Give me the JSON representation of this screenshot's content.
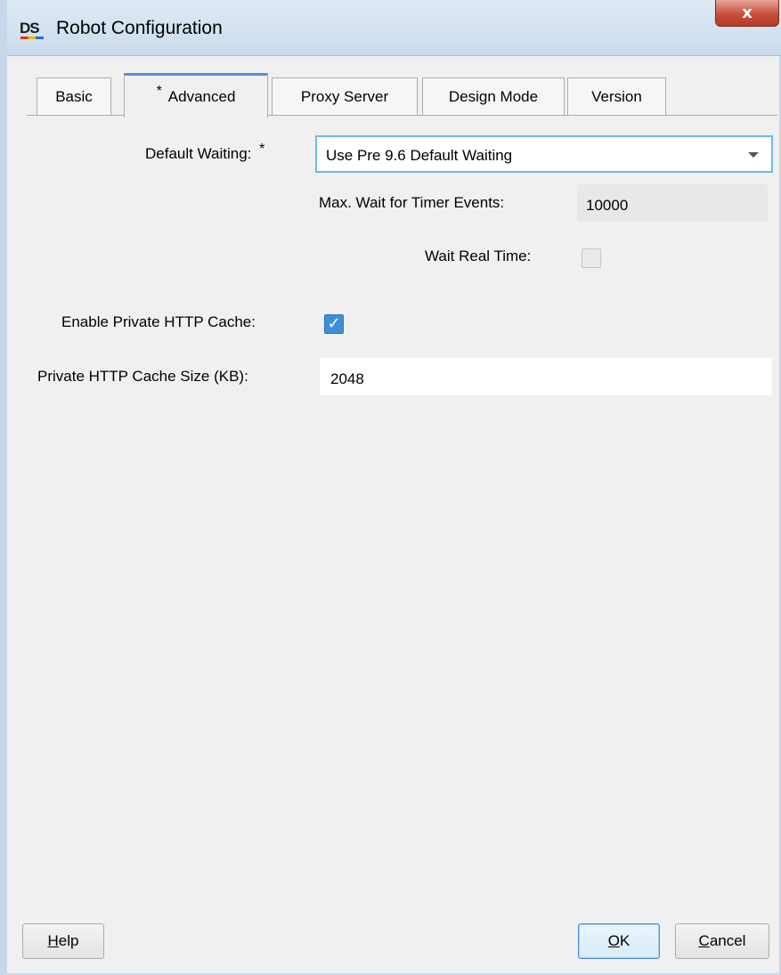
{
  "window": {
    "logo": "DS",
    "title": "Robot Configuration",
    "close_glyph": "x"
  },
  "tabs": [
    {
      "label": "Basic",
      "marker": "",
      "active": false
    },
    {
      "label": "Advanced",
      "marker": "*",
      "active": true
    },
    {
      "label": "Proxy Server",
      "marker": "",
      "active": false
    },
    {
      "label": "Design Mode",
      "marker": "",
      "active": false
    },
    {
      "label": "Version",
      "marker": "",
      "active": false
    }
  ],
  "advanced": {
    "default_waiting_label": "Default Waiting:",
    "default_waiting_marker": "*",
    "default_waiting_value": "Use Pre 9.6 Default Waiting",
    "max_wait_label": "Max. Wait for Timer Events:",
    "max_wait_value": "10000",
    "wait_real_time_label": "Wait Real Time:",
    "wait_real_time_checked": false,
    "enable_cache_label": "Enable Private HTTP Cache:",
    "enable_cache_checked": true,
    "cache_size_label": "Private HTTP Cache Size (KB):",
    "cache_size_value": "2048"
  },
  "buttons": {
    "help": {
      "accel": "H",
      "rest": "elp"
    },
    "ok": {
      "accel": "O",
      "rest": "K"
    },
    "cancel": {
      "accel": "C",
      "rest": "ancel"
    }
  },
  "colors": {
    "accent": "#5a8fd6",
    "checkbox_checked": "#3f8fd8",
    "dropdown_focus": "#6cbbe8",
    "close_button": "#c7503a"
  },
  "icons": {
    "close": "close-icon",
    "dropdown": "chevron-down-icon",
    "check": "checkmark-icon"
  }
}
